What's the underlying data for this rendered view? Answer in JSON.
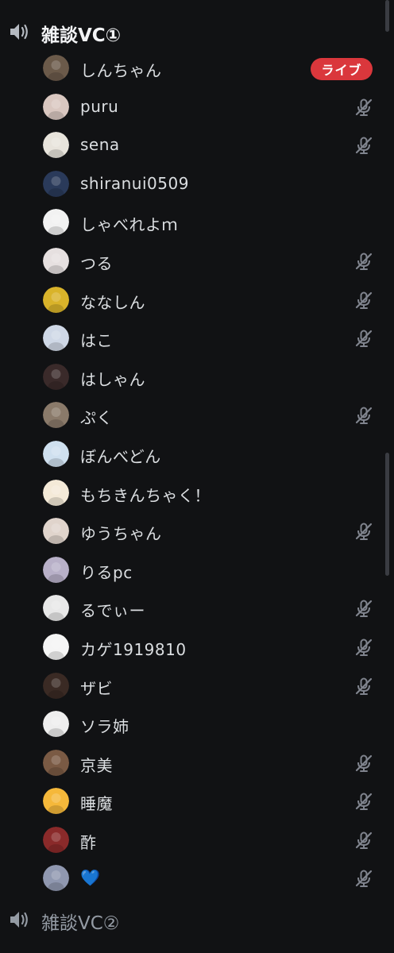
{
  "channels": [
    {
      "name": "雑談VC①",
      "icon": "speaker-icon"
    },
    {
      "name": "雑談VC②",
      "icon": "speaker-icon"
    }
  ],
  "live_label": "ライブ",
  "users": [
    {
      "name": "しんちゃん",
      "muted": false,
      "live": true,
      "avatar_color": "#6b5a4a"
    },
    {
      "name": "puru",
      "muted": true,
      "live": false,
      "avatar_color": "#d9c7c0"
    },
    {
      "name": "sena",
      "muted": true,
      "live": false,
      "avatar_color": "#e8e4dc"
    },
    {
      "name": "shiranui0509",
      "muted": false,
      "live": false,
      "avatar_color": "#2a3a5a"
    },
    {
      "name": "しゃべれよｍ",
      "muted": false,
      "live": false,
      "avatar_color": "#f2f2f2"
    },
    {
      "name": "つる",
      "muted": true,
      "live": false,
      "avatar_color": "#e6e0e0"
    },
    {
      "name": "ななしん",
      "muted": true,
      "live": false,
      "avatar_color": "#d9b32a"
    },
    {
      "name": "はこ",
      "muted": true,
      "live": false,
      "avatar_color": "#cfd8e6"
    },
    {
      "name": "はしゃん",
      "muted": false,
      "live": false,
      "avatar_color": "#3a2a2a"
    },
    {
      "name": "ぷく",
      "muted": true,
      "live": false,
      "avatar_color": "#8a7a6a"
    },
    {
      "name": "ぼんべどん",
      "muted": false,
      "live": false,
      "avatar_color": "#cfe0ef"
    },
    {
      "name": "もちきんちゃく！",
      "muted": false,
      "live": false,
      "avatar_color": "#f4ead8"
    },
    {
      "name": "ゆうちゃん",
      "muted": true,
      "live": false,
      "avatar_color": "#e0d4cc"
    },
    {
      "name": "りるpc",
      "muted": false,
      "live": false,
      "avatar_color": "#b8b0c8"
    },
    {
      "name": "るでぃー",
      "muted": true,
      "live": false,
      "avatar_color": "#e8e8e8"
    },
    {
      "name": "カゲ1919810",
      "muted": true,
      "live": false,
      "avatar_color": "#f5f5f5"
    },
    {
      "name": "ザビ",
      "muted": true,
      "live": false,
      "avatar_color": "#3a2a24"
    },
    {
      "name": "ソラ姉",
      "muted": false,
      "live": false,
      "avatar_color": "#eeeeee"
    },
    {
      "name": "京美",
      "muted": true,
      "live": false,
      "avatar_color": "#7a5a44"
    },
    {
      "name": "睡魔",
      "muted": true,
      "live": false,
      "avatar_color": "#f5b83a"
    },
    {
      "name": "酢",
      "muted": true,
      "live": false,
      "avatar_color": "#8a2a2a"
    },
    {
      "name": "💙",
      "muted": true,
      "live": false,
      "avatar_color": "#9098b0"
    }
  ],
  "colors": {
    "background": "#111214",
    "live_badge": "#da373c",
    "muted_icon": "#80848e",
    "username": "#dbdee1"
  }
}
